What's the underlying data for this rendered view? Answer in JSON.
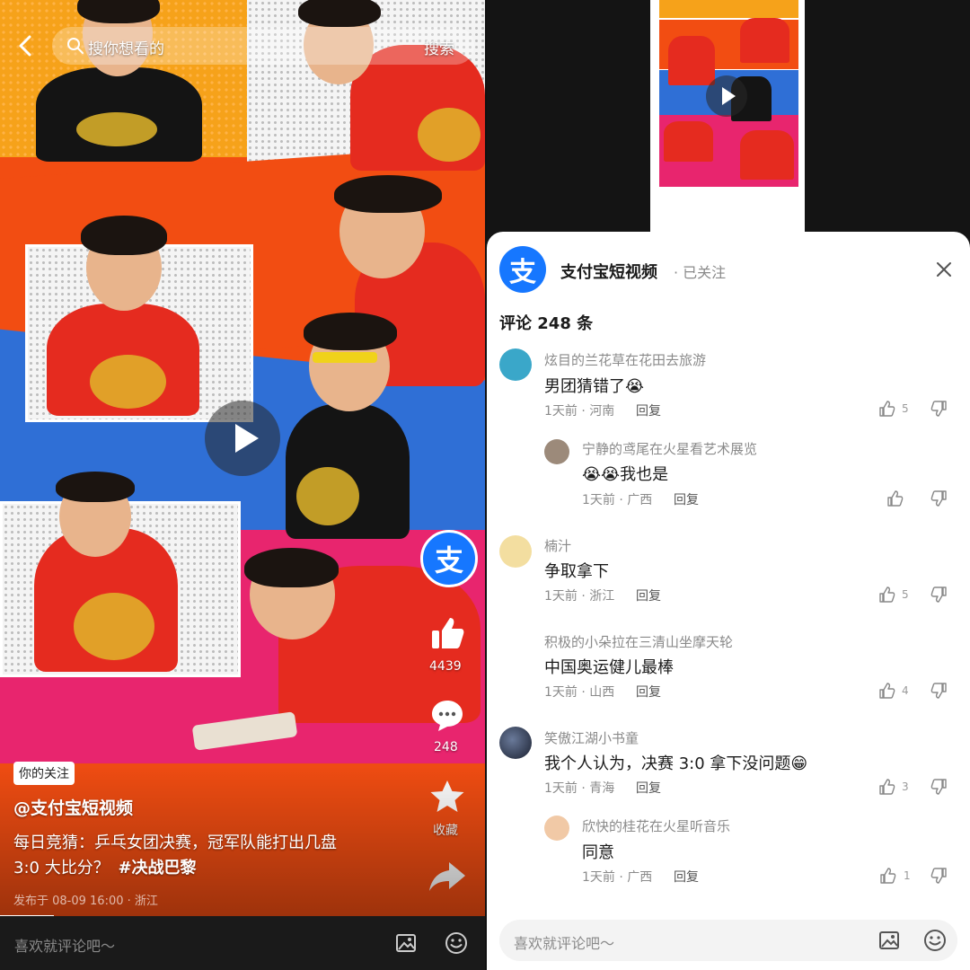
{
  "left": {
    "search_placeholder": "搜你想看的",
    "search_button": "搜索",
    "like_count": "4439",
    "comment_count": "248",
    "favorite_label": "收藏",
    "follow_tag": "你的关注",
    "author": "@支付宝短视频",
    "description_line1": "每日竞猜：乒乓女团决赛，冠军队能打出几盘",
    "description_line2_plain": "3:0 大比分？",
    "description_hashtag": "#决战巴黎",
    "publish_info": "发布于 08-09 16:00 · 浙江",
    "comment_placeholder": "喜欢就评论吧～",
    "logo_char": "支"
  },
  "right": {
    "channel_name": "支付宝短视频",
    "follow_status": "· 已关注",
    "comment_header": "评论 248 条",
    "comment_placeholder": "喜欢就评论吧～",
    "logo_char": "支",
    "comments": [
      {
        "name": "炫目的兰花草在花田去旅游",
        "text": "男团猜错了",
        "emoji": "😭",
        "meta": "1天前 · 河南",
        "reply": "回复",
        "likes": "5"
      },
      {
        "name": "宁静的鸢尾在火星看艺术展览",
        "text": "我也是",
        "emoji": "😭😭",
        "meta": "1天前 · 广西",
        "reply": "回复",
        "likes": ""
      },
      {
        "name": "楠汁",
        "text": "争取拿下",
        "emoji": "",
        "meta": "1天前 · 浙江",
        "reply": "回复",
        "likes": "5"
      },
      {
        "name": "积极的小朵拉在三清山坐摩天轮",
        "text": "中国奥运健儿最棒",
        "emoji": "",
        "meta": "1天前 · 山西",
        "reply": "回复",
        "likes": "4"
      },
      {
        "name": "笑傲江湖小书童",
        "text": "我个人认为，决赛 3:0 拿下没问题",
        "emoji": "😁",
        "meta": "1天前 · 青海",
        "reply": "回复",
        "likes": "3"
      },
      {
        "name": "欣快的桂花在火星听音乐",
        "text": "同意",
        "emoji": "",
        "meta": "1天前 · 广西",
        "reply": "回复",
        "likes": "1"
      }
    ]
  },
  "colors": {
    "alipay_blue": "#1677ff",
    "jersey_red": "#e52b1f",
    "panel_orange": "#f24d12",
    "panel_blue": "#2f6fd6",
    "panel_pink": "#e8256e",
    "panel_yellow": "#f6a21a"
  },
  "icons": [
    "back-icon",
    "search-icon",
    "play-icon",
    "thumb-up-icon",
    "comment-icon",
    "star-icon",
    "share-icon",
    "image-icon",
    "emoji-icon",
    "close-icon",
    "like-icon",
    "dislike-icon"
  ]
}
